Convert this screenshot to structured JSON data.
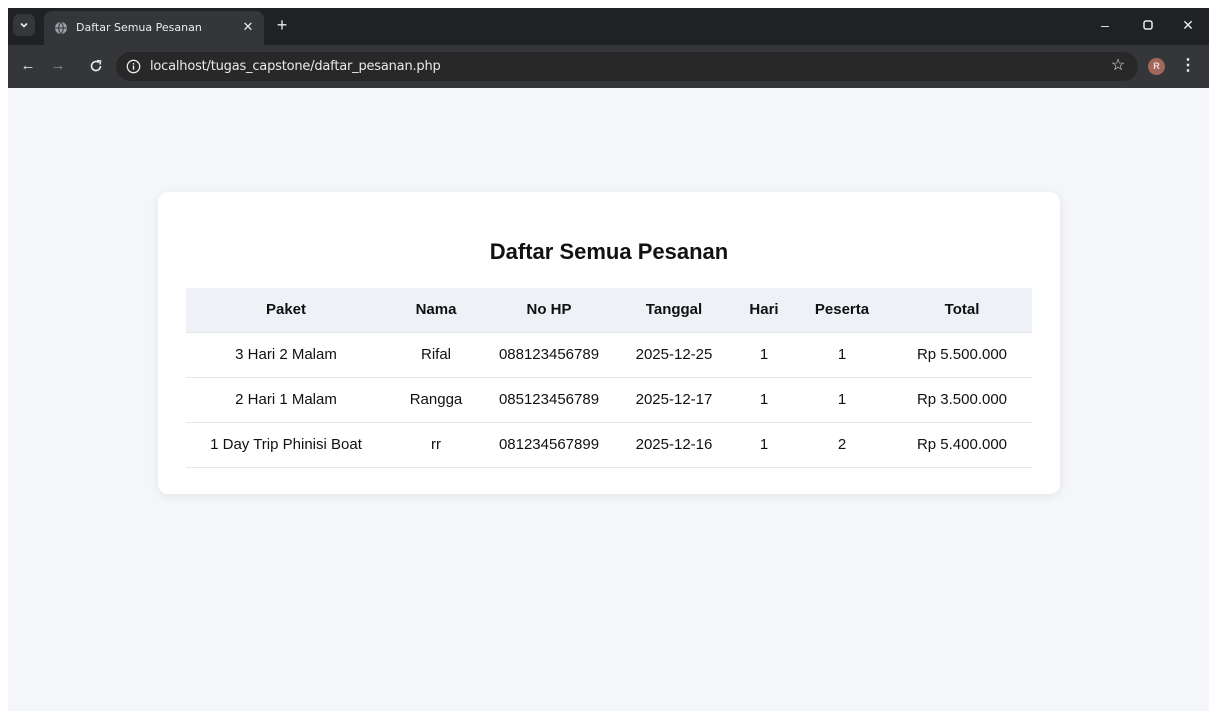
{
  "browser": {
    "tab_title": "Daftar Semua Pesanan",
    "url": "localhost/tugas_capstone/daftar_pesanan.php",
    "profile_initial": "R"
  },
  "page": {
    "title": "Daftar Semua Pesanan",
    "columns": [
      "Paket",
      "Nama",
      "No HP",
      "Tanggal",
      "Hari",
      "Peserta",
      "Total"
    ],
    "rows": [
      [
        "3 Hari 2 Malam",
        "Rifal",
        "088123456789",
        "2025-12-25",
        "1",
        "1",
        "Rp 5.500.000"
      ],
      [
        "2 Hari 1 Malam",
        "Rangga",
        "085123456789",
        "2025-12-17",
        "1",
        "1",
        "Rp 3.500.000"
      ],
      [
        "1 Day Trip Phinisi Boat",
        "rr",
        "081234567899",
        "2025-12-16",
        "1",
        "2",
        "Rp 5.400.000"
      ]
    ]
  },
  "colors": {
    "chrome_dark": "#202124",
    "chrome_toolbar": "#35363a",
    "page_background": "#f4f6fa",
    "card_background": "#ffffff",
    "table_header_background": "#eef1f6"
  }
}
